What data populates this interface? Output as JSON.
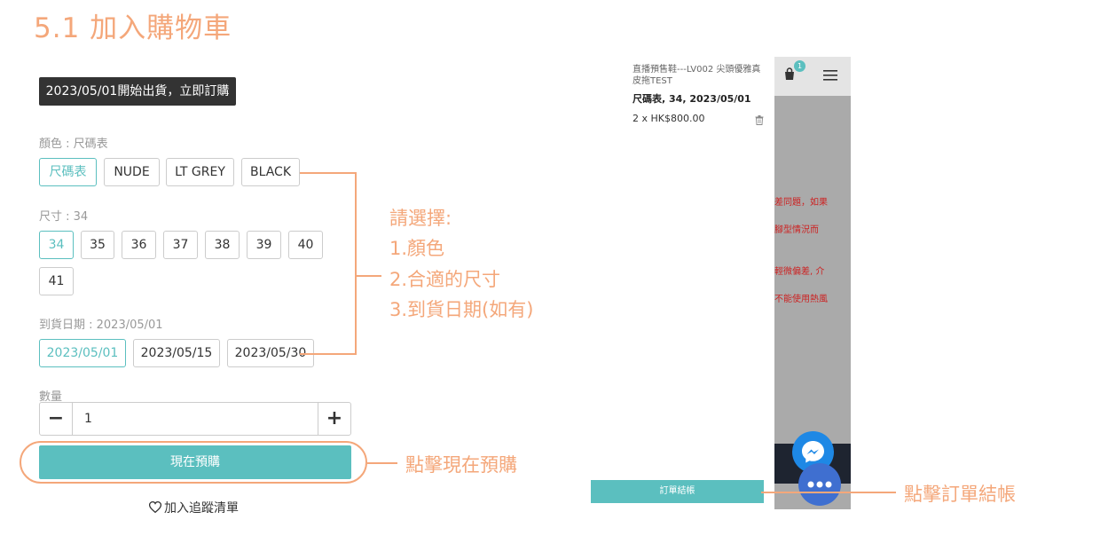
{
  "heading": "5.1 加入購物車",
  "banner": "2023/05/01開始出貨，立即訂購",
  "color": {
    "label": "顏色 : 尺碼表",
    "options": [
      "尺碼表",
      "NUDE",
      "LT GREY",
      "BLACK"
    ],
    "selected": "尺碼表"
  },
  "size": {
    "label": "尺寸 : 34",
    "options": [
      "34",
      "35",
      "36",
      "37",
      "38",
      "39",
      "40",
      "41"
    ],
    "selected": "34"
  },
  "date": {
    "label": "到貨日期 : 2023/05/01",
    "options": [
      "2023/05/01",
      "2023/05/15",
      "2023/05/30"
    ],
    "selected": "2023/05/01"
  },
  "quantity": {
    "label": "數量",
    "value": "1",
    "minus": "−",
    "plus": "+"
  },
  "buy_button": "現在預購",
  "wishlist": "加入追蹤清單",
  "annotation_select": [
    "請選擇:",
    "1.顏色",
    "2.合適的尺寸",
    "3.到貨日期(如有)"
  ],
  "annotation_buy": "點擊現在預購",
  "annotation_checkout": "點擊訂單結帳",
  "cart": {
    "badge": "1",
    "item_title": "直播預售鞋---LV002 尖頭優雅真皮拖TEST",
    "item_variant": "尺碼表, 34, 2023/05/01",
    "item_qty_price": "2 x  HK$800.00",
    "checkout_button": "訂單結帳"
  },
  "background_text": [
    "差同題，如果",
    "腳型情況而",
    "輕微偏差, 介",
    "不能使用熱風"
  ],
  "colors": {
    "accent": "#5bbfbf",
    "annotation": "#f4a77a",
    "dark": "#333333"
  }
}
